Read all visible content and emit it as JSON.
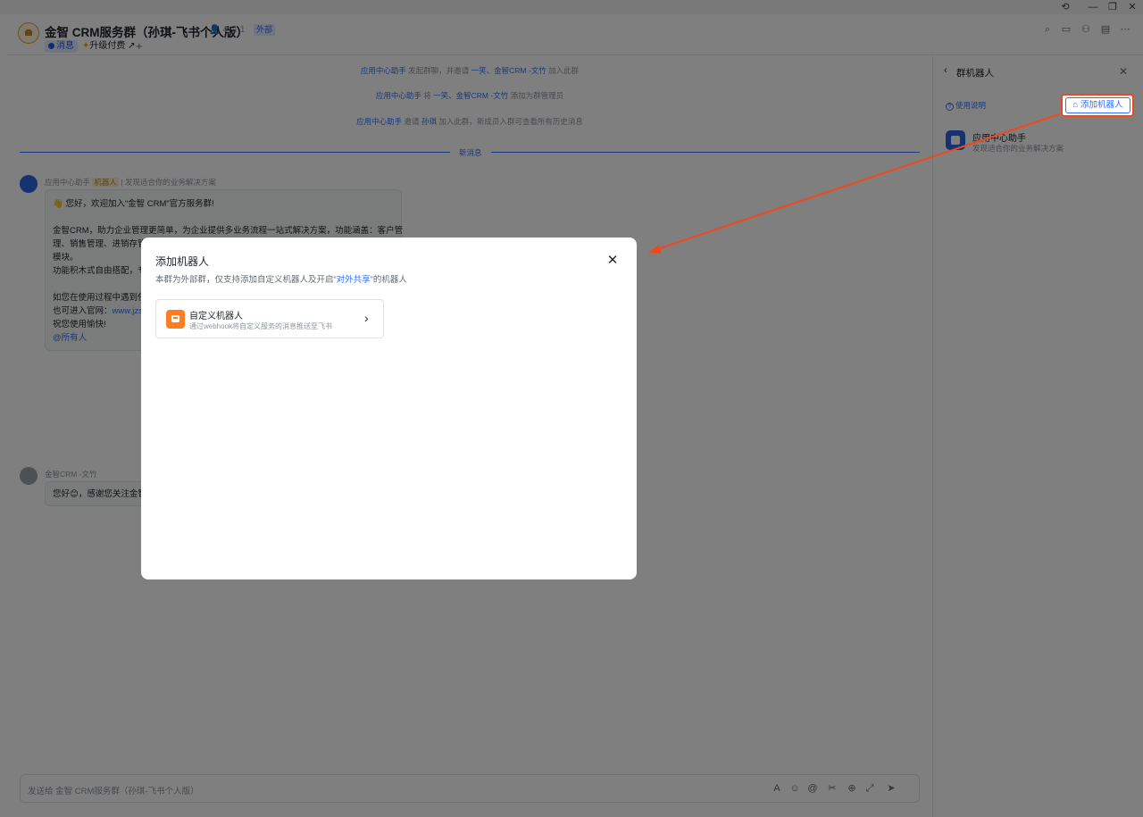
{
  "window": {
    "history_icon": "history-icon",
    "minimize": "—",
    "restore": "❐",
    "close": "✕"
  },
  "header": {
    "title": "金智 CRM服务群（孙琪-飞书个人版）",
    "members": "4",
    "bots": "1",
    "external_badge": "外部",
    "tabs": [
      {
        "label": "消息"
      },
      {
        "label": "升级付费"
      },
      {
        "label": "+"
      }
    ]
  },
  "chat": {
    "system": [
      {
        "actor": "应用中心助手",
        "mid": "发起群聊，并邀请",
        "names": "一笑、金智CRM -文竹",
        "tail": "加入此群"
      },
      {
        "actor": "应用中心助手",
        "mid": "将",
        "names": "一笑、金智CRM -文竹",
        "tail": "添加为群管理员"
      },
      {
        "actor": "应用中心助手",
        "mid": "邀请",
        "names": "孙琪",
        "tail": "加入此群，新成员入群可查看所有历史消息"
      }
    ],
    "new_msg_divider": "新消息",
    "msg1": {
      "sender": "应用中心助手",
      "tag": "机器人",
      "sender_desc": "发现适合你的业务解决方案",
      "lines": [
        "👋 您好，欢迎加入“金智 CRM”官方服务群!",
        "",
        "金智CRM，助力企业管理更简单，为企业提供多业务流程一站式解决方案，功能涵盖：客户管",
        "理、销售管理、进销存管",
        "模块。",
        "功能积木式自由搭配，专",
        "",
        "如您在使用过程中遇到任",
        "也可进入官网：",
        "祝您使用愉快!",
        "@所有人"
      ],
      "link": "www.jzs"
    },
    "msg2": {
      "sender": "金智CRM -文竹",
      "text": "您好😊，感谢您关注金智"
    },
    "input_placeholder": "发送给 金智 CRM服务群（孙琪-飞书个人版）"
  },
  "right_panel": {
    "title": "群机器人",
    "help": "使用说明",
    "add_button": "添加机器人",
    "bot_name": "应用中心助手",
    "bot_desc": "发现适合你的业务解决方案"
  },
  "modal": {
    "title": "添加机器人",
    "subtitle_pre": "本群为外部群，仅支持添加自定义机器人及开启“",
    "subtitle_link": "对外共享",
    "subtitle_post": "”的机器人",
    "card_title": "自定义机器人",
    "card_desc": "通过webhook将自定义服务的消息推送至飞书"
  },
  "annotation": {
    "highlight_color": "#f1471d"
  }
}
